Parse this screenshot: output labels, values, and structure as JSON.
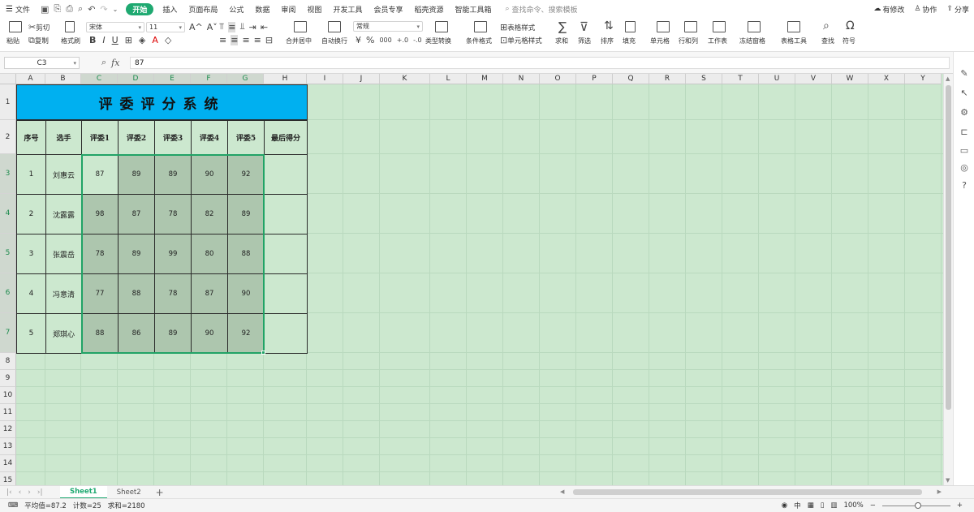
{
  "menubar": {
    "file": "文件",
    "tabs": [
      "开始",
      "插入",
      "页面布局",
      "公式",
      "数据",
      "审阅",
      "视图",
      "开发工具",
      "会员专享",
      "稻壳资源",
      "智能工具箱"
    ],
    "active_tab": "开始",
    "search_placeholder": "查找命令、搜索模板",
    "modify": "有修改",
    "collab": "协作",
    "share": "分享"
  },
  "ribbon": {
    "paste": "粘贴",
    "cut": "剪切",
    "copy": "复制",
    "format_painter": "格式刷",
    "font_name": "宋体",
    "font_size": "11",
    "merge_center": "合并居中",
    "wrap_text": "自动换行",
    "number_format": "常规",
    "type_convert": "类型转换",
    "conditional_format": "条件格式",
    "table_style": "表格样式",
    "cell_style": "单元格样式",
    "sum": "求和",
    "filter": "筛选",
    "sort": "排序",
    "fill": "填充",
    "cell": "单元格",
    "row_col": "行和列",
    "worksheet": "工作表",
    "freeze": "冻结窗格",
    "table_tools": "表格工具",
    "find": "查找",
    "symbol": "符号"
  },
  "formula_bar": {
    "cell_ref": "C3",
    "formula": "87"
  },
  "columns": [
    "A",
    "B",
    "C",
    "D",
    "E",
    "F",
    "G",
    "H",
    "I",
    "J",
    "K",
    "L",
    "M",
    "N",
    "O",
    "P",
    "Q",
    "R",
    "S",
    "T",
    "U",
    "V",
    "W",
    "X",
    "Y"
  ],
  "rows": [
    "1",
    "2",
    "3",
    "4",
    "5",
    "6",
    "7",
    "8",
    "9",
    "10",
    "11",
    "12",
    "13",
    "14",
    "15"
  ],
  "sheet": {
    "title": "评委评分系统",
    "headers": [
      "序号",
      "选手",
      "评委1",
      "评委2",
      "评委3",
      "评委4",
      "评委5",
      "最后得分"
    ],
    "records": [
      {
        "no": "1",
        "name": "刘惠云",
        "scores": [
          "87",
          "89",
          "89",
          "90",
          "92"
        ],
        "final": ""
      },
      {
        "no": "2",
        "name": "沈露露",
        "scores": [
          "98",
          "87",
          "78",
          "82",
          "89"
        ],
        "final": ""
      },
      {
        "no": "3",
        "name": "张震岳",
        "scores": [
          "78",
          "89",
          "99",
          "80",
          "88"
        ],
        "final": ""
      },
      {
        "no": "4",
        "name": "冯意清",
        "scores": [
          "77",
          "88",
          "78",
          "87",
          "90"
        ],
        "final": ""
      },
      {
        "no": "5",
        "name": "郑琪心",
        "scores": [
          "88",
          "86",
          "89",
          "90",
          "92"
        ],
        "final": ""
      }
    ]
  },
  "sheet_tabs": [
    "Sheet1",
    "Sheet2"
  ],
  "active_sheet": "Sheet1",
  "status": {
    "average": "平均值=87.2",
    "count": "计数=25",
    "sum": "求和=2180",
    "zoom": "100%"
  },
  "colors": {
    "title_fill": "#00b0f0",
    "sheet_bg": "#cce8cf",
    "selected_fill": "#adc6ae",
    "accent": "#1fa971"
  }
}
